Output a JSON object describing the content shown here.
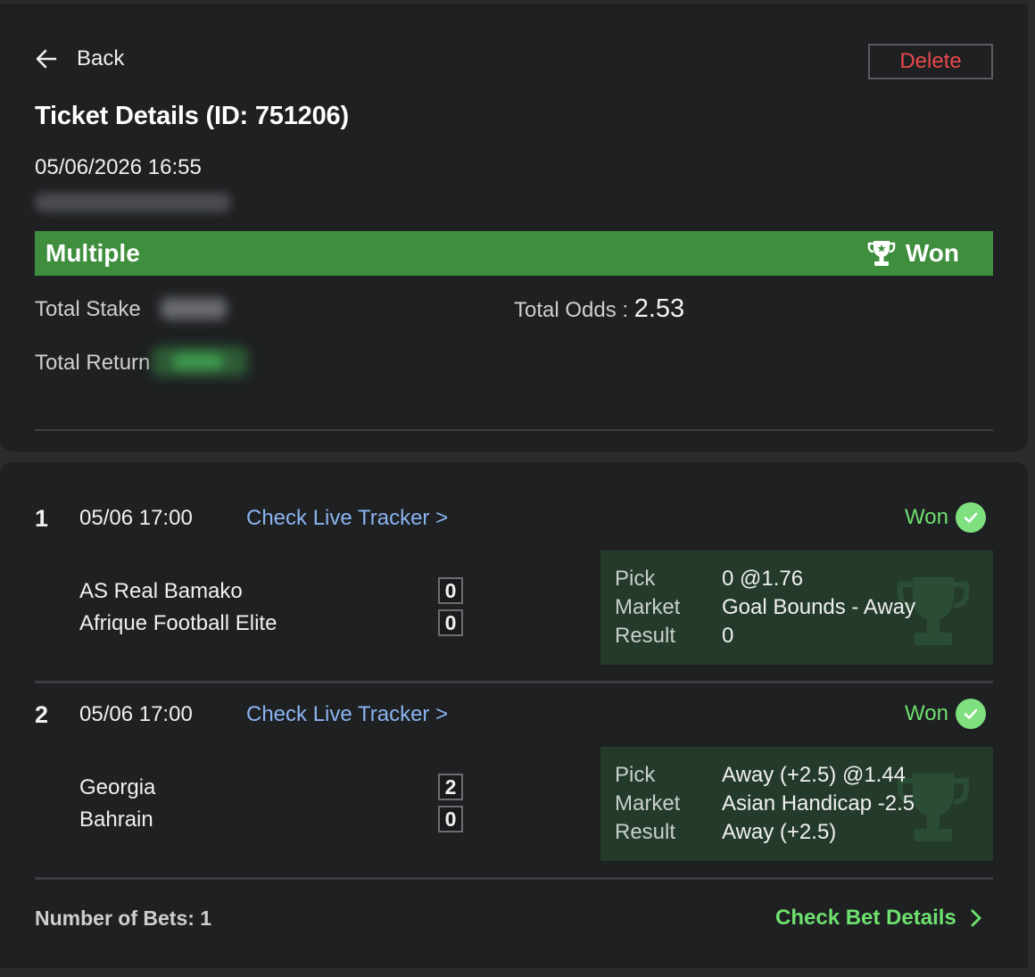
{
  "header": {
    "back_label": "Back",
    "delete_label": "Delete",
    "title": "Ticket Details (ID: 751206)",
    "datetime": "05/06/2026 16:55"
  },
  "ticket": {
    "type": "Multiple",
    "status": "Won",
    "total_stake_label": "Total Stake",
    "total_odds_label": "Total Odds :",
    "total_odds_value": "2.53",
    "total_return_label": "Total Return"
  },
  "bets": [
    {
      "number": "1",
      "time": "05/06 17:00",
      "tracker_label": "Check Live Tracker >",
      "status": "Won",
      "home_team": "AS Real Bamako",
      "away_team": "Afrique Football Elite",
      "home_score": "0",
      "away_score": "0",
      "pick_label": "Pick",
      "pick_value": "0 @1.76",
      "market_label": "Market",
      "market_value": "Goal Bounds - Away",
      "result_label": "Result",
      "result_value": "0"
    },
    {
      "number": "2",
      "time": "05/06 17:00",
      "tracker_label": "Check Live Tracker >",
      "status": "Won",
      "home_team": "Georgia",
      "away_team": "Bahrain",
      "home_score": "2",
      "away_score": "0",
      "pick_label": "Pick",
      "pick_value": "Away (+2.5) @1.44",
      "market_label": "Market",
      "market_value": "Asian Handicap -2.5",
      "result_label": "Result",
      "result_value": "Away (+2.5)"
    }
  ],
  "footer": {
    "bets_count": "Number of Bets: 1",
    "details_link": "Check Bet Details"
  },
  "colors": {
    "status_bar": "#3e8e3e",
    "won_text": "#6ee06e",
    "delete_text": "#e84a4a",
    "tracker_link": "#8bb4f0",
    "pick_box": "#243b2c"
  },
  "icons": [
    "arrow-left-icon",
    "trophy-icon",
    "check-circle-icon",
    "chevron-right-icon"
  ]
}
